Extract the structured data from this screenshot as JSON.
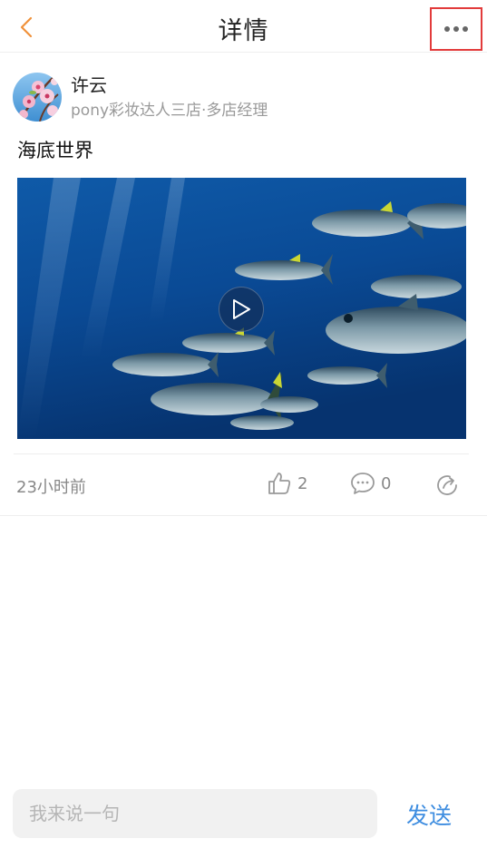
{
  "header": {
    "title": "详情",
    "back_icon": "chevron-left-icon",
    "more_icon": "more-horizontal-icon",
    "accent": "#f0913a",
    "highlight_border": "#e23b3b"
  },
  "post": {
    "author_name": "许云",
    "author_role": "pony彩妆达人三店·多店经理",
    "text": "海底世界",
    "video_icon": "play-icon",
    "timestamp": "23小时前",
    "like_count": "2",
    "comment_count": "0",
    "like_icon": "thumbs-up-icon",
    "comment_icon": "comment-bubble-icon",
    "share_icon": "share-icon"
  },
  "composer": {
    "placeholder": "我来说一句",
    "value": "",
    "send_label": "发送",
    "send_color": "#3e8de0"
  }
}
